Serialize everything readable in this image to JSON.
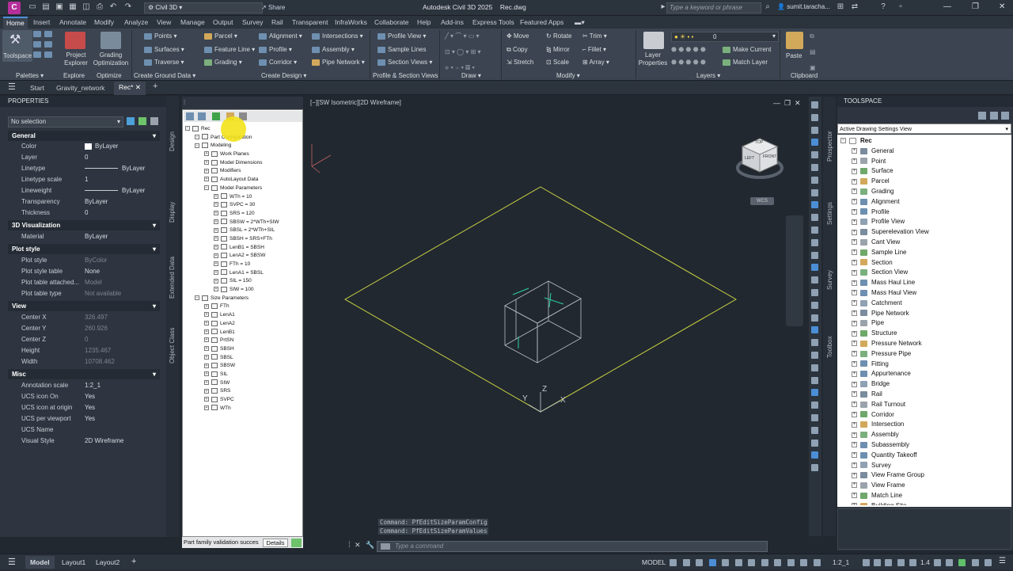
{
  "titlebar": {
    "app_title": "Autodesk Civil 3D 2025",
    "doc_name": "Rec.dwg",
    "workspace": "Civil 3D",
    "share_label": "Share",
    "search_placeholder": "Type a keyword or phrase",
    "user": "sumit.taracha..."
  },
  "menu_tabs": [
    "Home",
    "Insert",
    "Annotate",
    "Modify",
    "Analyze",
    "View",
    "Manage",
    "Output",
    "Survey",
    "Rail",
    "Transparent",
    "InfraWorks",
    "Collaborate",
    "Help",
    "Add-ins",
    "Express Tools",
    "Featured Apps"
  ],
  "ribbon": {
    "toolspace": "Toolspace",
    "project_explorer": "Project Explorer",
    "grading_optimization": "Grading Optimization",
    "create_ground": [
      "Points",
      "Surfaces",
      "Traverse"
    ],
    "create_design_a": [
      "Parcel",
      "Feature Line",
      "Grading"
    ],
    "create_design_b": [
      "Alignment",
      "Profile",
      "Corridor"
    ],
    "create_design_c": [
      "Intersections",
      "Assembly",
      "Pipe Network"
    ],
    "profile_section": [
      "Profile View",
      "Sample Lines",
      "Section Views"
    ],
    "modify_a": [
      "Move",
      "Copy",
      "Stretch"
    ],
    "modify_b": [
      "Rotate",
      "Mirror",
      "Scale"
    ],
    "modify_c": [
      "Trim",
      "Fillet",
      "Array"
    ],
    "layer_props": "Layer Properties",
    "layer_value": "0",
    "make_current": "Make Current",
    "match_layer": "Match Layer",
    "paste": "Paste",
    "panels": [
      "Palettes",
      "Explore",
      "Optimize",
      "Create Ground Data",
      "Create Design",
      "Profile & Section Views",
      "Draw",
      "Modify",
      "Layers",
      "Clipboard"
    ]
  },
  "doc_tabs": [
    "Start",
    "Gravity_network",
    "Rec*"
  ],
  "properties": {
    "title": "PROPERTIES",
    "selection": "No selection",
    "sections": [
      {
        "name": "General",
        "rows": [
          [
            "Color",
            "ByLayer"
          ],
          [
            "Layer",
            "0"
          ],
          [
            "Linetype",
            "ByLayer"
          ],
          [
            "Linetype scale",
            "1"
          ],
          [
            "Lineweight",
            "ByLayer"
          ],
          [
            "Transparency",
            "ByLayer"
          ],
          [
            "Thickness",
            "0"
          ]
        ]
      },
      {
        "name": "3D Visualization",
        "rows": [
          [
            "Material",
            "ByLayer"
          ]
        ]
      },
      {
        "name": "Plot style",
        "rows": [
          [
            "Plot style",
            "ByColor"
          ],
          [
            "Plot style table",
            "None"
          ],
          [
            "Plot table attached...",
            "Model"
          ],
          [
            "Plot table type",
            "Not available"
          ]
        ]
      },
      {
        "name": "View",
        "rows": [
          [
            "Center X",
            "326.497"
          ],
          [
            "Center Y",
            "260.926"
          ],
          [
            "Center Z",
            "0"
          ],
          [
            "Height",
            "1235.467"
          ],
          [
            "Width",
            "10708.462"
          ]
        ]
      },
      {
        "name": "Misc",
        "rows": [
          [
            "Annotation scale",
            "1:2_1"
          ],
          [
            "UCS icon On",
            "Yes"
          ],
          [
            "UCS icon at origin",
            "Yes"
          ],
          [
            "UCS per viewport",
            "Yes"
          ],
          [
            "UCS Name",
            ""
          ],
          [
            "Visual Style",
            "2D Wireframe"
          ]
        ]
      }
    ],
    "side_tabs": [
      "Design",
      "Display",
      "Extended Data",
      "Object Class"
    ]
  },
  "part_tree": {
    "nodes": [
      {
        "t": "Rec",
        "d": 0
      },
      {
        "t": "Part Configuration",
        "d": 1
      },
      {
        "t": "Modeling",
        "d": 1
      },
      {
        "t": "Work Planes",
        "d": 2
      },
      {
        "t": "Model Dimensions",
        "d": 2
      },
      {
        "t": "Modifiers",
        "d": 2
      },
      {
        "t": "AutoLayout Data",
        "d": 2
      },
      {
        "t": "Model Parameters",
        "d": 2
      },
      {
        "t": "WTh = 10",
        "d": 3
      },
      {
        "t": "SVPC = 30",
        "d": 3
      },
      {
        "t": "SRS = 120",
        "d": 3
      },
      {
        "t": "SBSW = 2*WTh+SIW",
        "d": 3
      },
      {
        "t": "SBSL = 2*WTh+SIL",
        "d": 3
      },
      {
        "t": "SBSH = SRS+FTh",
        "d": 3
      },
      {
        "t": "LenB1 = SBSH",
        "d": 3
      },
      {
        "t": "LenA2 = SBSW",
        "d": 3
      },
      {
        "t": "FTh = 10",
        "d": 3
      },
      {
        "t": "LenA1 = SBSL",
        "d": 3
      },
      {
        "t": "SIL = 150",
        "d": 3
      },
      {
        "t": "SIW = 100",
        "d": 3
      },
      {
        "t": "Size Parameters",
        "d": 1
      },
      {
        "t": "FTh",
        "d": 2
      },
      {
        "t": "LenA1",
        "d": 2
      },
      {
        "t": "LenA2",
        "d": 2
      },
      {
        "t": "LenB1",
        "d": 2
      },
      {
        "t": "PrtSN",
        "d": 2
      },
      {
        "t": "SBSH",
        "d": 2
      },
      {
        "t": "SBSL",
        "d": 2
      },
      {
        "t": "SBSW",
        "d": 2
      },
      {
        "t": "SIL",
        "d": 2
      },
      {
        "t": "SIW",
        "d": 2
      },
      {
        "t": "SRS",
        "d": 2
      },
      {
        "t": "SVPC",
        "d": 2
      },
      {
        "t": "WTh",
        "d": 2
      }
    ],
    "status": "Part family validation succes",
    "details_button": "Details"
  },
  "viewport": {
    "label": "[−][SW Isometric][2D Wireframe]",
    "wcs": "WCS",
    "cube_faces": [
      "TOP",
      "LEFT",
      "FRONT"
    ]
  },
  "command": {
    "history": [
      "Command: PfEditSizeParamConfig",
      "Command: PfEditSizeParamValues"
    ],
    "placeholder": "Type a command"
  },
  "toolspace": {
    "title": "TOOLSPACE",
    "view_select": "Active Drawing Settings View",
    "root": "Rec",
    "items": [
      "General",
      "Point",
      "Surface",
      "Parcel",
      "Grading",
      "Alignment",
      "Profile",
      "Profile View",
      "Superelevation View",
      "Cant View",
      "Sample Line",
      "Section",
      "Section View",
      "Mass Haul Line",
      "Mass Haul View",
      "Catchment",
      "Pipe Network",
      "Pipe",
      "Structure",
      "Pressure Network",
      "Pressure Pipe",
      "Fitting",
      "Appurtenance",
      "Bridge",
      "Rail",
      "Rail Turnout",
      "Corridor",
      "Intersection",
      "Assembly",
      "Subassembly",
      "Quantity Takeoff",
      "Survey",
      "View Frame Group",
      "View Frame",
      "Match Line",
      "Building Site"
    ],
    "side_tabs": [
      "Prospector",
      "Settings",
      "Survey",
      "Toolbox"
    ]
  },
  "statusbar": {
    "tabs": [
      "Model",
      "Layout1",
      "Layout2"
    ],
    "model_label": "MODEL",
    "scale": "1:2_1",
    "zoom": "1.4"
  },
  "colors": {
    "accent": "#4b8ed6",
    "ribbon_bg": "#3b4450",
    "viewport_bg": "#212830",
    "grid_line": "#c9d141",
    "model_line": "#2fd0a8"
  }
}
